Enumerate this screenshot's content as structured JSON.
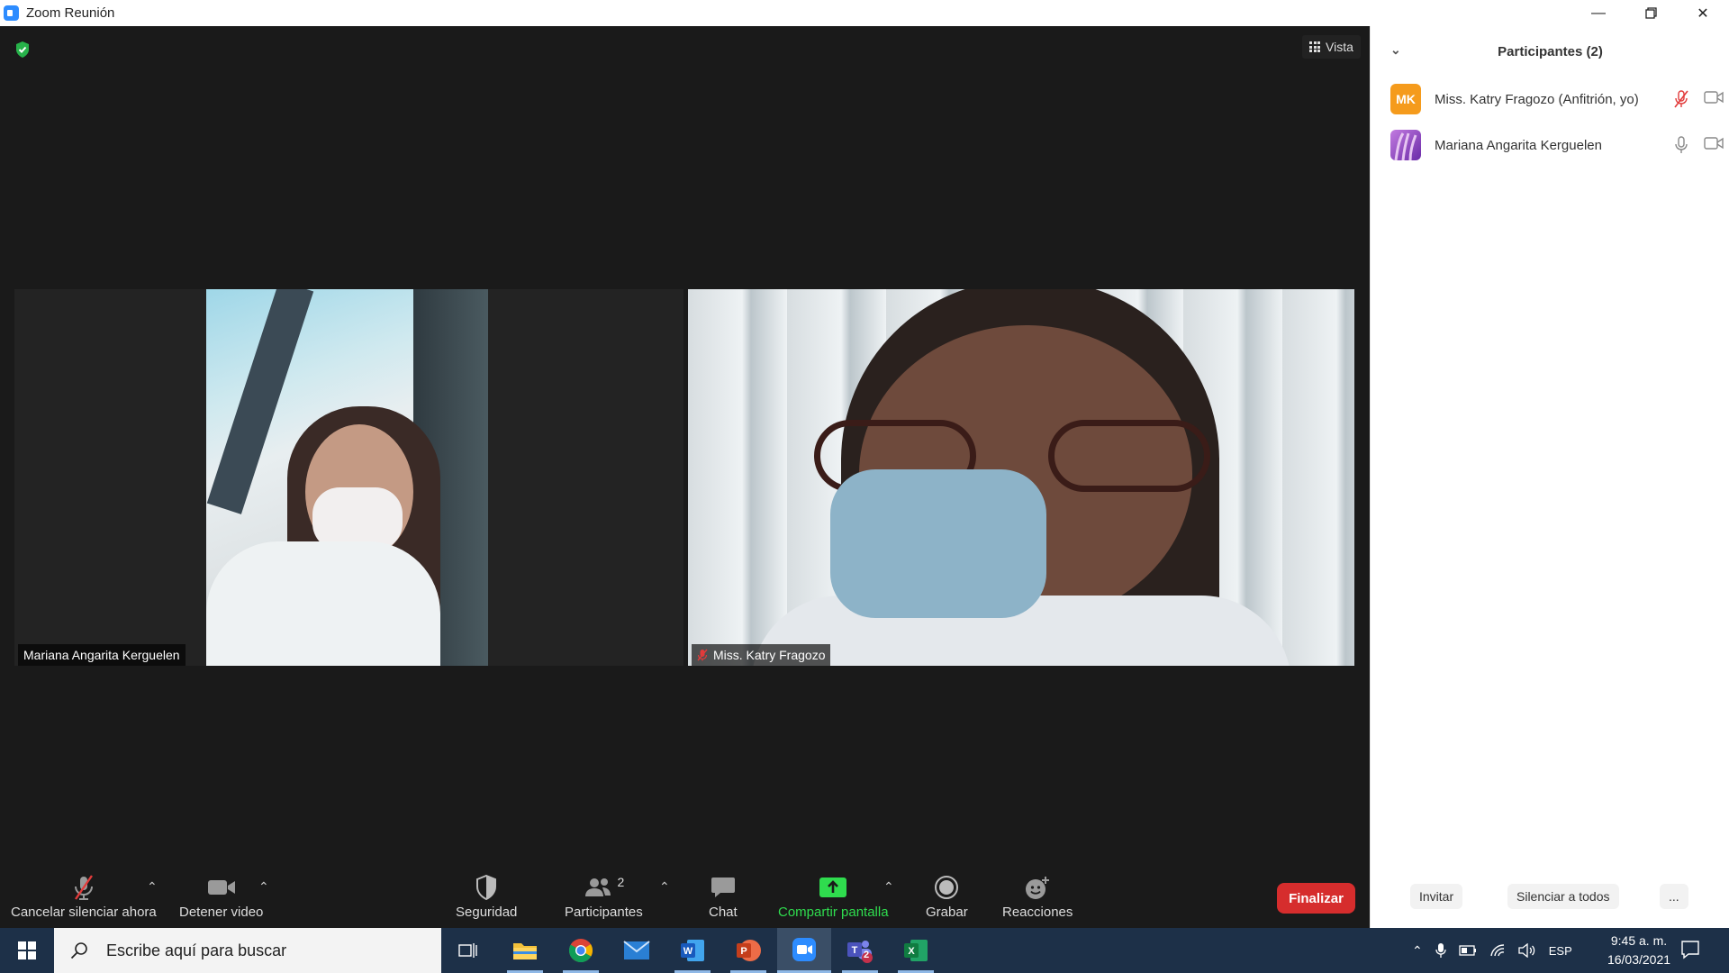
{
  "window": {
    "title": "Zoom Reunión",
    "controls": [
      "minimize",
      "maximize",
      "close"
    ]
  },
  "meeting": {
    "view_button_label": "Vista",
    "tiles": [
      {
        "name": "Mariana Angarita Kerguelen",
        "muted": false
      },
      {
        "name": "Miss. Katry Fragozo",
        "muted": true
      }
    ]
  },
  "toolbar": {
    "mute_label": "Cancelar silenciar ahora",
    "video_label": "Detener video",
    "security_label": "Seguridad",
    "participants_label": "Participantes",
    "participants_count": "2",
    "chat_label": "Chat",
    "share_label": "Compartir pantalla",
    "record_label": "Grabar",
    "reactions_label": "Reacciones",
    "end_label": "Finalizar",
    "colors": {
      "share": "#2fdc4e",
      "end": "#d62d2d"
    }
  },
  "panel": {
    "title": "Participantes (2)",
    "participants": [
      {
        "initials": "MK",
        "name": "Miss. Katry Fragozo (Anfitrión, yo)",
        "avatar_color": "#f59b1c",
        "mic": "muted",
        "video": "on"
      },
      {
        "initials": "",
        "name": "Mariana Angarita Kerguelen",
        "avatar_color": "#8b3fc7",
        "mic": "on",
        "video": "on"
      }
    ],
    "footer": {
      "invite_label": "Invitar",
      "mute_all_label": "Silenciar a todos",
      "more_label": "..."
    }
  },
  "taskbar": {
    "search_placeholder": "Escribe aquí para buscar",
    "apps": [
      "task-view",
      "file-explorer",
      "chrome",
      "mail",
      "word",
      "powerpoint",
      "zoom",
      "teams",
      "excel"
    ],
    "teams_badge": "2",
    "language": "ESP",
    "time": "9:45 a. m.",
    "date": "16/03/2021"
  }
}
